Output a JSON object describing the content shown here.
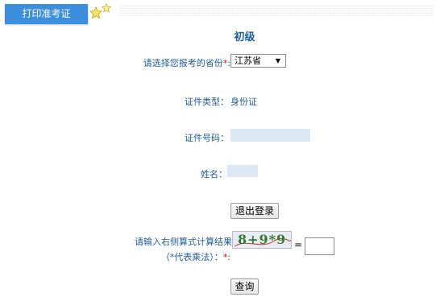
{
  "header": {
    "print_tab_label": "打印准考证"
  },
  "level_title": "初级",
  "form": {
    "province_label": "请选择您报考的省份",
    "province_value": "江苏省",
    "id_type_label": "证件类型：",
    "id_type_value": "身份证",
    "id_number_label": "证件号码：",
    "name_label": "姓名：",
    "logout_button": "退出登录",
    "captcha_label_line1": "请输入右侧算式计算结果",
    "captcha_label_line2": "（*代表乘法）：",
    "captcha_text": "8+9*9",
    "equals": "=",
    "query_button": "查询",
    "required_mark": "*",
    "colon": ":"
  },
  "colors": {
    "tab_bg": "#3b8fdc",
    "label": "#1f5c99",
    "required": "#e00000"
  },
  "icons": [
    "star-icon",
    "star-small-icon"
  ]
}
